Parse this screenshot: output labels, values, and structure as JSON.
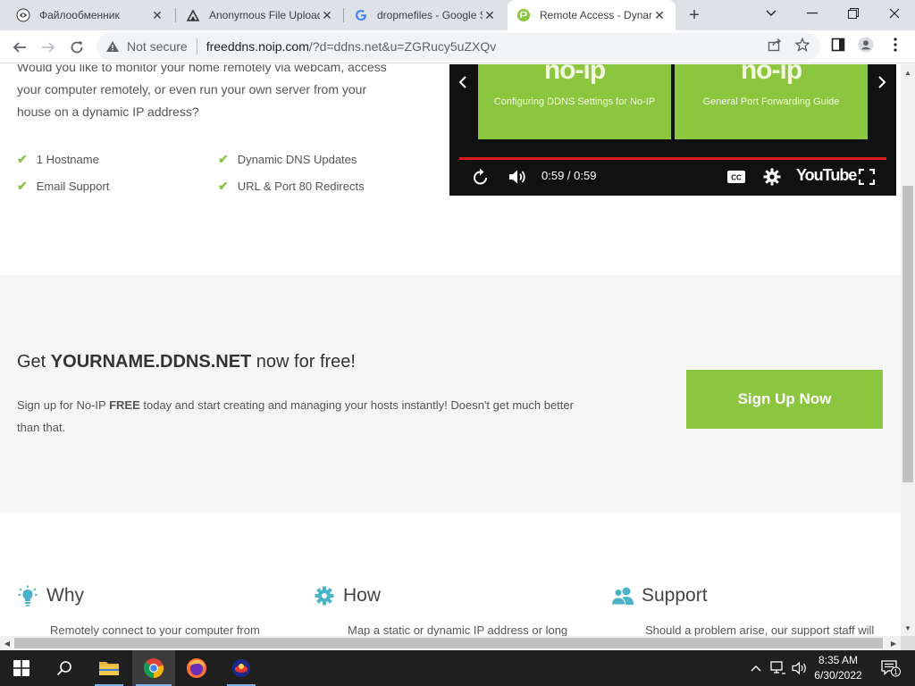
{
  "browser": {
    "tabs": [
      {
        "title": "Файлообменник",
        "favicon": "eye-icon",
        "active": false
      },
      {
        "title": "Anonymous File Upload",
        "favicon": "upload-icon",
        "active": false
      },
      {
        "title": "dropmefiles - Google Search",
        "favicon": "google-icon",
        "active": false
      },
      {
        "title": "Remote Access - Dynamic DNS",
        "favicon": "noip-icon",
        "active": true
      }
    ],
    "address": {
      "security_label": "Not secure",
      "host": "freeddns.noip.com",
      "path": "/?d=ddns.net&u=ZGRucy5uZXQv"
    }
  },
  "page": {
    "intro_text": "Would you like to monitor your home remotely via webcam, access your computer remotely, or even run your own server from your house on a dynamic IP address?",
    "features": [
      "1 Hostname",
      "Dynamic DNS Updates",
      "Email Support",
      "URL & Port 80 Redirects"
    ],
    "video": {
      "thumbnails": [
        {
          "logo": "no-ip",
          "caption": "Configuring DDNS Settings for No-IP"
        },
        {
          "logo": "no-ip",
          "caption": "General Port Forwarding Guide"
        }
      ],
      "time": "0:59 / 0:59",
      "brand": "YouTube",
      "progress": 1.0
    },
    "cta": {
      "headline_prefix": "Get ",
      "headline_bold": "YOURNAME.DDNS.NET",
      "headline_suffix": " now for free!",
      "body_prefix": "Sign up for No-IP ",
      "body_bold": "FREE",
      "body_suffix": " today and start creating and managing your hosts instantly! Doesn't get much better than that.",
      "button": "Sign Up Now"
    },
    "columns": [
      {
        "title": "Why",
        "icon": "lightbulb-icon",
        "text": "Remotely connect to your computer from"
      },
      {
        "title": "How",
        "icon": "gear-icon",
        "text": "Map a static or dynamic IP address or long"
      },
      {
        "title": "Support",
        "icon": "users-icon",
        "text": "Should a problem arise, our support staff will"
      }
    ]
  },
  "taskbar": {
    "time": "8:35 AM",
    "date": "6/30/2022",
    "notification_count": "1"
  },
  "colors": {
    "accent_green": "#8cc63f",
    "check_green": "#8bc34a",
    "video_progress": "#e01b1b"
  }
}
